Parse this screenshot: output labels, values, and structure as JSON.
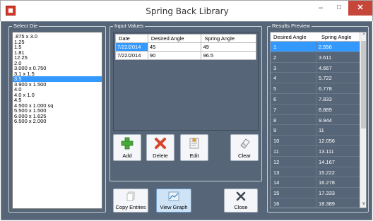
{
  "window": {
    "title": "Spring Back Library",
    "minimize_glyph": "–",
    "maximize_glyph": "□",
    "close_glyph": "✕"
  },
  "select_die": {
    "label": "Select Die",
    "items": [
      ".875 x 3.0",
      "1.25",
      "1.5",
      "1.81",
      "12.25",
      "2.0",
      "3.000 x 0.750",
      "3.1 x 1.5",
      "3.5",
      "3.900 x 1.500",
      "4.0",
      "4.0 x 1.0",
      "4.5",
      "4.500 x 1.000 sq",
      "5.500 x 1.500",
      "6.000 x 1.625",
      "6.500 x 2.000"
    ],
    "selected_index": 8
  },
  "input_values": {
    "label": "Input Values",
    "columns": [
      "Date",
      "Desired Angle",
      "Spring Angle"
    ],
    "rows": [
      [
        "7/22/2014",
        "45",
        "49"
      ],
      [
        "7/22/2014",
        "90",
        "96.5"
      ]
    ],
    "selected_cell": [
      0,
      0
    ]
  },
  "toolbar": {
    "add_label": "Add",
    "delete_label": "Delete",
    "edit_label": "Edit",
    "clear_label": "Clear"
  },
  "actions": {
    "copy_entries_label": "Copy Entries",
    "view_graph_label": "View Graph",
    "close_label": "Close"
  },
  "results_preview": {
    "label": "Results Preview",
    "columns": [
      "Desired Angle",
      "Spring Angle"
    ],
    "rows": [
      [
        "1",
        "2.556"
      ],
      [
        "2",
        "3.611"
      ],
      [
        "3",
        "4.667"
      ],
      [
        "4",
        "5.722"
      ],
      [
        "5",
        "6.778"
      ],
      [
        "6",
        "7.833"
      ],
      [
        "7",
        "8.889"
      ],
      [
        "8",
        "9.944"
      ],
      [
        "9",
        "11"
      ],
      [
        "10",
        "12.056"
      ],
      [
        "11",
        "13.111"
      ],
      [
        "12",
        "14.167"
      ],
      [
        "13",
        "15.222"
      ],
      [
        "14",
        "16.278"
      ],
      [
        "15",
        "17.333"
      ],
      [
        "16",
        "18.389"
      ]
    ],
    "selected_index": 0
  },
  "colors": {
    "client_bg": "#566577",
    "selection": "#3399ff",
    "close_button": "#c7463a"
  }
}
